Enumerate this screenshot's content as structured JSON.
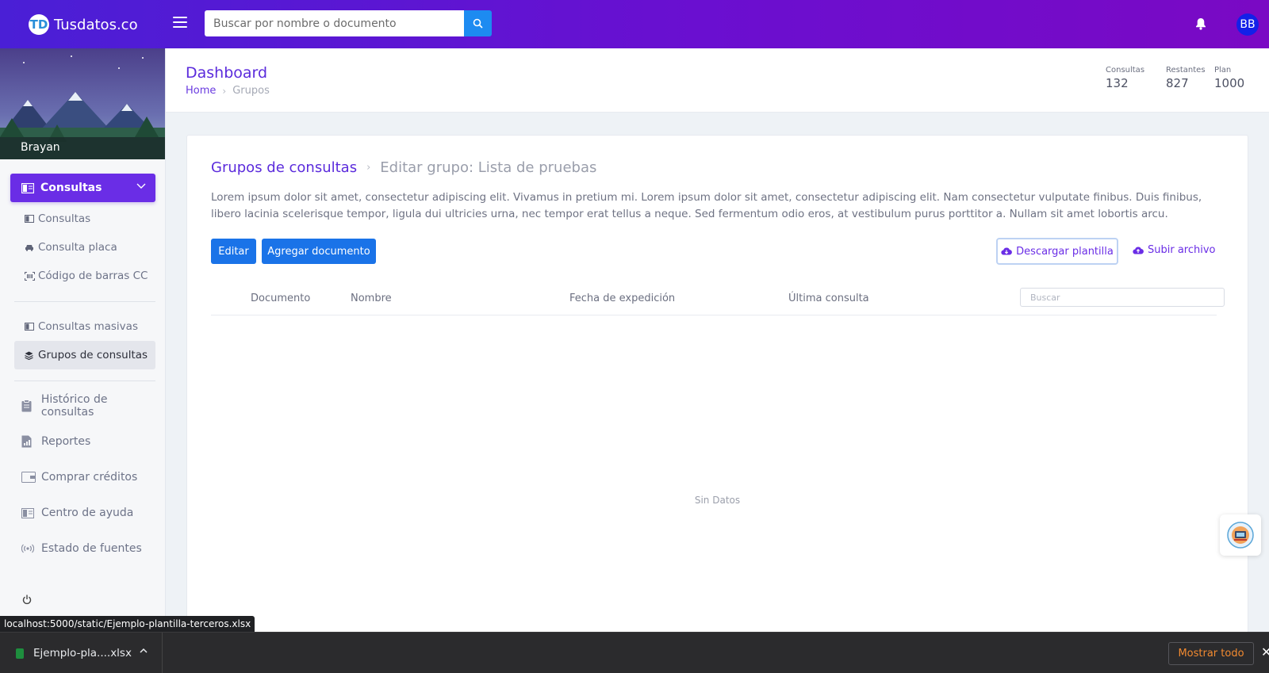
{
  "app": {
    "brand_initials": "TD",
    "brand_name": "Tusdatos.co"
  },
  "header": {
    "search_placeholder": "Buscar por nombre o documento",
    "avatar_initials": "BB"
  },
  "sidebar": {
    "user_name": "Brayan",
    "main_item": {
      "label": "Consultas",
      "icon": "book-icon"
    },
    "sub_items": [
      {
        "label": "Consultas",
        "icon": "book-icon"
      },
      {
        "label": "Consulta placa",
        "icon": "car-icon"
      },
      {
        "label": "Código de barras CC",
        "icon": "barcode-icon"
      },
      {
        "label": "Consultas masivas",
        "icon": "book-icon"
      },
      {
        "label": "Grupos de consultas",
        "icon": "layers-icon",
        "active": true
      }
    ],
    "items": [
      {
        "label": "Histórico de consultas",
        "icon": "clipboard-icon"
      },
      {
        "label": "Reportes",
        "icon": "report-icon"
      },
      {
        "label": "Comprar créditos",
        "icon": "wallet-icon"
      },
      {
        "label": "Centro de ayuda",
        "icon": "book-icon"
      },
      {
        "label": "Estado de fuentes",
        "icon": "broadcast-icon"
      }
    ]
  },
  "page": {
    "title": "Dashboard",
    "breadcrumb": {
      "home": "Home",
      "current": "Grupos"
    },
    "stats": [
      {
        "label": "Consultas",
        "value": "132"
      },
      {
        "label": "Restantes",
        "value": "827"
      },
      {
        "label": "Plan",
        "value": "1000"
      }
    ]
  },
  "card": {
    "title_link": "Grupos de consultas",
    "title_current": "Editar grupo: Lista de pruebas",
    "description": "Lorem ipsum dolor sit amet, consectetur adipiscing elit. Vivamus in pretium mi. Lorem ipsum dolor sit amet, consectetur adipiscing elit. Nam consectetur vulputate finibus. Duis finibus, libero lacinia scelerisque tempor, ligula dui ultricies urna, nec tempor erat tellus a neque. Sed fermentum odio eros, at vestibulum purus porttitor a. Nullam sit amet lobortis arcu.",
    "buttons": {
      "edit": "Editar",
      "add_document": "Agregar documento",
      "download_template": "Descargar plantilla",
      "upload_file": "Subir archivo"
    },
    "table": {
      "columns": [
        "Documento",
        "Nombre",
        "Fecha de expedición",
        "Última consulta"
      ],
      "search_placeholder": "Buscar",
      "empty_text": "Sin Datos"
    }
  },
  "status_url": "localhost:5000/static/Ejemplo-plantilla-terceros.xlsx",
  "downloads": {
    "file_name": "Ejemplo-pla....xlsx",
    "show_all": "Mostrar todo"
  },
  "colors": {
    "accent": "#6a2de6",
    "primary_button": "#1a73e8",
    "topbar_start": "#4a1fd6",
    "topbar_end": "#7a09c4"
  }
}
